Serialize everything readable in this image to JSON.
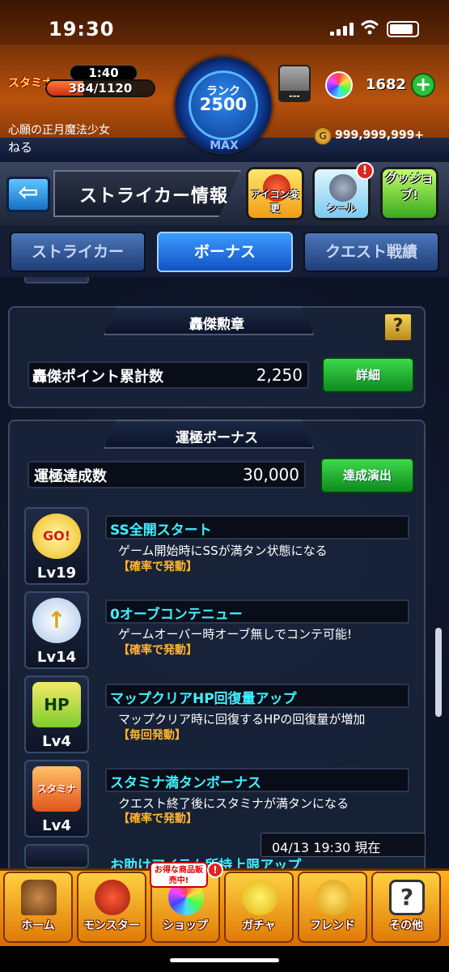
{
  "status_bar": {
    "time": "19:30"
  },
  "header": {
    "stamina_label": "スタミナ",
    "stamina_timer": "1:40",
    "stamina_value": "384/1120",
    "stamina_fraction": 0.343,
    "rank_label": "ランク",
    "rank_value": "2500",
    "rank_max": "MAX",
    "title": "心願の正月魔法少女",
    "player_name": "ねる",
    "seal_value": "---",
    "orb_count": "1682",
    "gold": "999,999,999+"
  },
  "subheader": {
    "page_title": "ストライカー情報",
    "icon_change_label": "アイコン変更",
    "seal_label": "シール",
    "good_job_label": "グッジョブ!",
    "alert": "!"
  },
  "tabs": [
    {
      "label": "ストライカー"
    },
    {
      "label": "ボーナス"
    },
    {
      "label": "クエスト戦績"
    }
  ],
  "medal_panel": {
    "title": "轟傑勲章",
    "help": "?",
    "points_label": "轟傑ポイント累計数",
    "points_value": "2,250",
    "detail_button": "詳細"
  },
  "luck_panel": {
    "title": "運極ボーナス",
    "count_label": "運極達成数",
    "count_value": "30,000",
    "achievement_button": "達成演出"
  },
  "bonuses": [
    {
      "emblem": "GO!",
      "level": "Lv19",
      "name": "SS全開スタート",
      "desc": "ゲーム開始時にSSが満タン状態になる",
      "trigger": "【確率で発動】"
    },
    {
      "emblem": "↑",
      "level": "Lv14",
      "name": "0オーブコンテニュー",
      "desc": "ゲームオーバー時オーブ無しでコンテ可能!",
      "trigger": "【確率で発動】"
    },
    {
      "emblem": "HP",
      "level": "Lv4",
      "name": "マップクリアHP回復量アップ",
      "desc": "マップクリア時に回復するHPの回復量が増加",
      "trigger": "【毎回発動】"
    },
    {
      "emblem": "スタミナ",
      "level": "Lv4",
      "name": "スタミナ満タンボーナス",
      "desc": "クエスト終了後にスタミナが満タンになる",
      "trigger": "【確率で発動】"
    },
    {
      "name": "お助けアイテム所持上限アップ"
    }
  ],
  "datetime": "04/13 19:30 現在",
  "bottom_nav": [
    {
      "label": "ホーム",
      "icon": "home-icon"
    },
    {
      "label": "モンスター",
      "icon": "monster-icon"
    },
    {
      "label": "ショップ",
      "icon": "shop-icon",
      "promo": "お得な商品販売中!",
      "alert": "!"
    },
    {
      "label": "ガチャ",
      "icon": "gacha-icon"
    },
    {
      "label": "フレンド",
      "icon": "friend-icon"
    },
    {
      "label": "その他",
      "icon": "other-icon"
    }
  ]
}
